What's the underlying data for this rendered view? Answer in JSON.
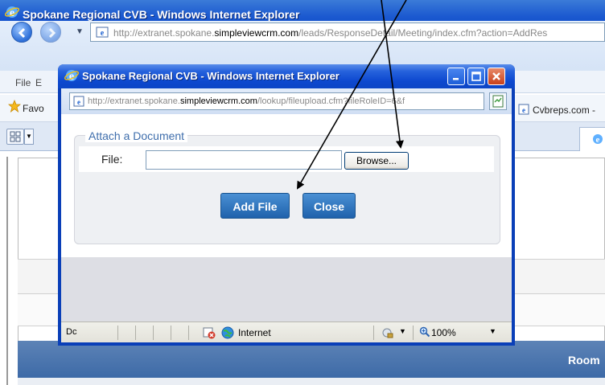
{
  "main_window": {
    "title": "Spokane Regional CVB - Windows Internet Explorer",
    "url_prefix": "http://extranet.spokane.",
    "url_host": "simpleviewcrm.com",
    "url_path": "/leads/ResponseDetail/Meeting/index.cfm?action=AddRes",
    "menu": {
      "file": "File",
      "edit": "E"
    },
    "favorites_label": "Favo",
    "favorites_link": "Cvbreps.com -",
    "content_header": "Room"
  },
  "popup": {
    "title": "Spokane Regional CVB - Windows Internet Explorer",
    "url_prefix": "http://extranet.spokane.",
    "url_host": "simpleviewcrm.com",
    "url_path": "/lookup/fileupload.cfm?fileRoleID=6&f",
    "form": {
      "legend": "Attach a Document",
      "file_label": "File:",
      "file_value": "",
      "browse_label": "Browse...",
      "add_file_label": "Add File",
      "close_label": "Close"
    },
    "status": {
      "text": "Dc",
      "zone": "Internet",
      "zoom": "100%"
    }
  },
  "colors": {
    "titlebar": "#0a46c4",
    "button_primary": "#2f79c4",
    "legend_text": "#3f6eac",
    "header_band": "#4a74ae"
  }
}
